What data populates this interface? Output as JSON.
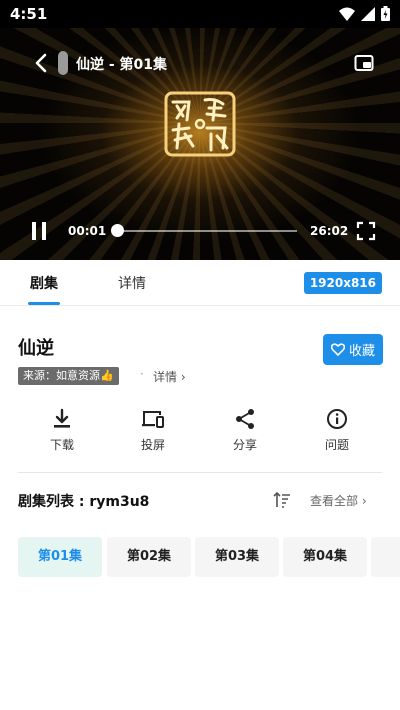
{
  "status_bar": {
    "time": "4:51"
  },
  "player": {
    "title": "仙逆 - 第01集",
    "current_time": "00:01",
    "duration": "26:02",
    "progress": 0.0006
  },
  "tabs": [
    {
      "label": "剧集",
      "active": true
    },
    {
      "label": "详情",
      "active": false
    }
  ],
  "resolution": "1920x816",
  "show": {
    "title": "仙逆",
    "favorite_label": "收藏",
    "source": "来源：如意资源👍",
    "separator": "·",
    "detail_label": "详情 ›"
  },
  "actions": [
    {
      "label": "下载",
      "icon": "download-icon"
    },
    {
      "label": "投屏",
      "icon": "cast-icon"
    },
    {
      "label": "分享",
      "icon": "share-icon"
    },
    {
      "label": "问题",
      "icon": "info-icon"
    }
  ],
  "episode_list": {
    "header": "剧集列表 : rym3u8",
    "view_all": "查看全部 ›",
    "episodes": [
      "第01集",
      "第02集",
      "第03集",
      "第04集",
      ""
    ],
    "active_index": 0
  },
  "colors": {
    "accent": "#1d8fe8",
    "active_episode_bg": "#e5f5f2"
  }
}
